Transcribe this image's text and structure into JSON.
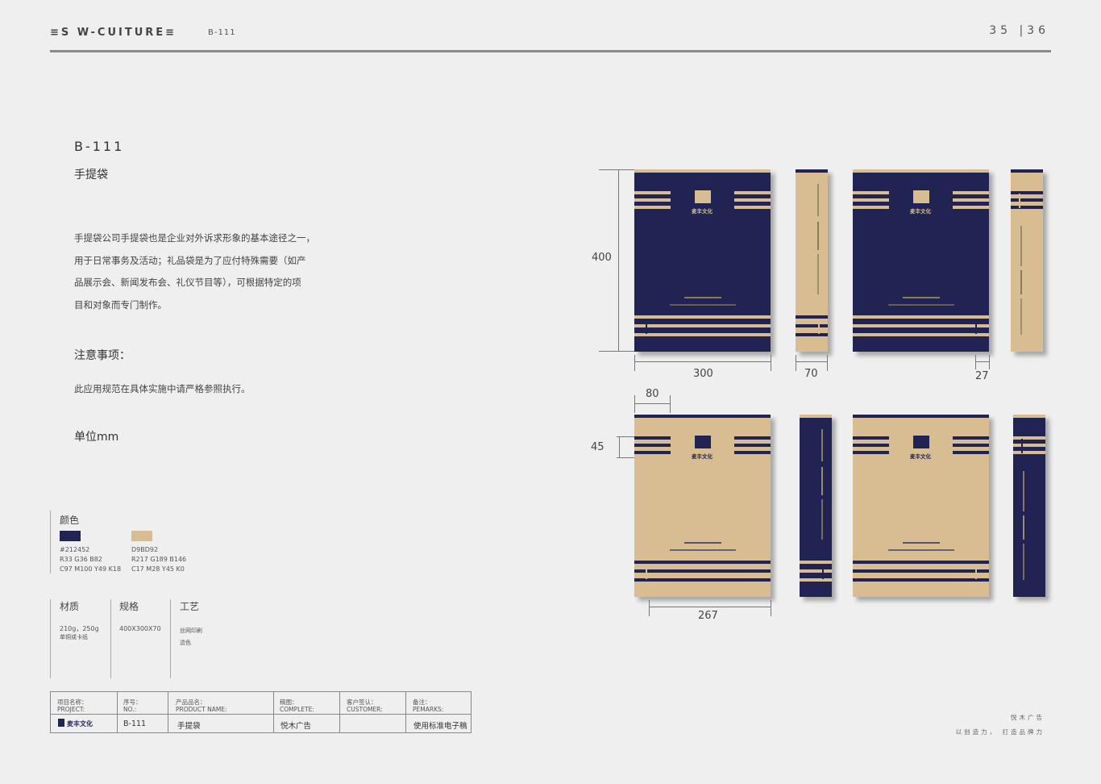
{
  "header": {
    "brand": "≡S  W-CUITURE≡",
    "code": "B-111",
    "page": "35  |36"
  },
  "title": {
    "code": "B-111",
    "name": "手提袋"
  },
  "description": [
    "手提袋公司手提袋也是企业对外诉求形象的基本途径之一，",
    "用于日常事务及活动；礼品袋是为了应付特殊需要（如产",
    "品展示会、新闻发布会、礼仪节目等），可根据特定的项",
    "目和对象而专门制作。"
  ],
  "notice": {
    "heading": "注意事项：",
    "text": "此应用规范在具体实施中请严格参照执行。"
  },
  "unit_label": "单位mm",
  "colors": {
    "heading": "颜色",
    "items": [
      {
        "hex": "#212452",
        "lines": [
          "#212452",
          "R33 G36 B82",
          "C97 M100 Y49 K18"
        ]
      },
      {
        "hex": "#D9BD92",
        "lines": [
          "D9BD92",
          "R217 G189 B146",
          "C17 M28 Y45 K0"
        ]
      }
    ]
  },
  "specs": [
    {
      "heading": "材质",
      "lines": [
        "210g，250g",
        "单铜或卡纸"
      ]
    },
    {
      "heading": "规格",
      "lines": [
        "400X300X70"
      ]
    },
    {
      "heading": "工艺",
      "lines": [
        "丝网印刷",
        "烫色"
      ]
    }
  ],
  "table": {
    "labels": [
      [
        "项目名称：",
        "PROJECT:"
      ],
      [
        "序号：",
        "NO.:"
      ],
      [
        "产品品名：",
        "PRODUCT NAME:"
      ],
      [
        "稿图：",
        "COMPLETE:"
      ],
      [
        "客户签认：",
        "CUSTOMER:"
      ],
      [
        "备注：",
        "PEMARKS:"
      ]
    ],
    "values": [
      "",
      "B-111",
      "手提袋",
      "悦木广告",
      "",
      "使用标准电子稿"
    ],
    "logo_text": "麦丰文化"
  },
  "footer": {
    "line1": "悦木广告",
    "line2": "以创造力，  打造品牌力"
  },
  "dimensions": {
    "height": "400",
    "width": "300",
    "depth": "70",
    "gusset": "27",
    "offset": "80",
    "strip": "45",
    "inner": "267"
  },
  "bag_logo_text": "麦丰文化"
}
